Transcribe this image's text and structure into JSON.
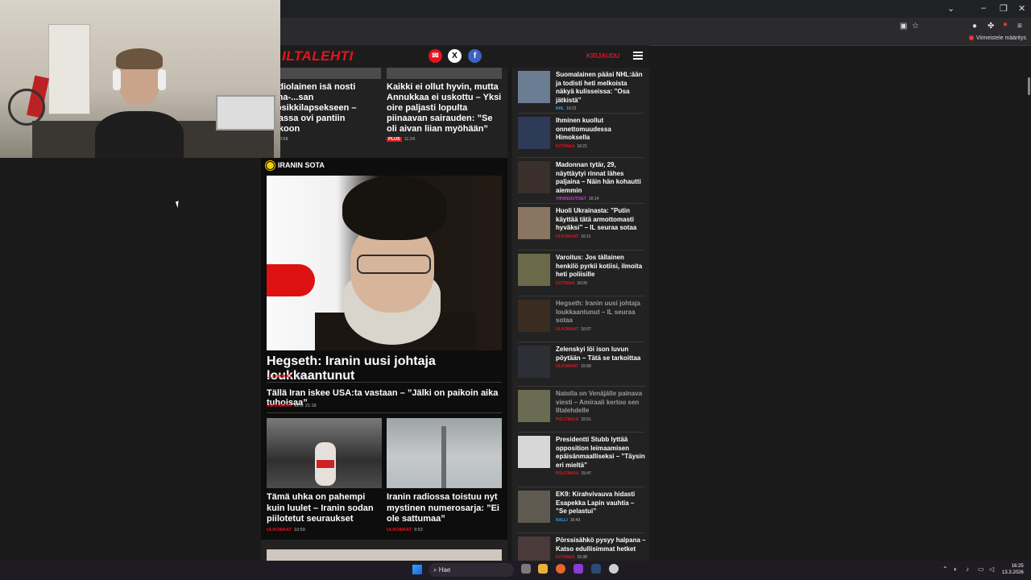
{
  "browser": {
    "bookmark_label": "Viimeistele määritys",
    "minimize": "–",
    "restore": "❐",
    "close": "✕",
    "dropdown": "⌄"
  },
  "site": {
    "logo": "ILTALEHTI",
    "header_right": "KIRJAUDU"
  },
  "top_articles": [
    {
      "title": "...adiolainen isä nosti Anna-...san suosikkilapsekseen – ...nassa ovi pantiin lukkoon",
      "time": "12.3. 20:58",
      "category": ""
    },
    {
      "title": "Kaikki ei ollut hyvin, mutta Annukkaa ei uskottu – Yksi oire paljasti lopulta piinaavan sairauden: ”Se oli aivan liian myöhään”",
      "time": "11:24",
      "badge": "PLUS"
    }
  ],
  "section": {
    "label": "IRANIN SOTA",
    "hero_title": "Hegseth: Iranin uusi johtaja loukkaantunut",
    "hero_category": "ULKOMAAT",
    "hero_time": "16:07",
    "sub_title": "Tällä Iran iskee USA:ta vastaan – ”Jälki on paikoin aika tuhoisaa”",
    "sub_category": "ULKOMAAT",
    "sub_time": "12.3. 21:18",
    "cards": [
      {
        "title": "Tämä uhka on pahempi kuin luulet – Iranin sodan piilotetut seuraukset",
        "category": "ULKOMAAT",
        "time": "10:59"
      },
      {
        "title": "Iranin radiossa toistuu nyt mystinen numerosarja: ”Ei ole sattumaa”",
        "category": "ULKOMAAT",
        "time": "9:53"
      }
    ]
  },
  "sidebar": [
    {
      "title": "Suomalainen pääsi NHL:ään ja todisti heti melkoista näkyä kulisseissa: ”Osa jätkistä”",
      "category": "NHL",
      "cat_color": "#2aa0e6",
      "time": "16:21",
      "dim": false
    },
    {
      "title": "Ihminen kuollut onnettomuudessa Himoksella",
      "category": "KOTIMAA",
      "cat_color": "#e5141d",
      "time": "16:21",
      "dim": false
    },
    {
      "title": "Madonnan tytär, 29, näyttäytyi rinnat lähes paljaina – Näin hän kohautti aiemmin",
      "category": "VIIHDEUUTISET",
      "cat_color": "#c63fd0",
      "time": "16:14",
      "dim": false
    },
    {
      "title": "Huoli Ukrainasta: ”Putin käyttää tätä armottomasti hyväksi” – IL seuraa sotaa",
      "category": "ULKOMAAT",
      "cat_color": "#e5141d",
      "time": "16:11",
      "dim": false
    },
    {
      "title": "Varoitus: Jos tällainen henkilö pyrkii kotiisi, ilmoita heti poliisille",
      "category": "KOTIMAA",
      "cat_color": "#e5141d",
      "time": "16:09",
      "dim": false
    },
    {
      "title": "Hegseth: Iranin uusi johtaja loukkaantunut – IL seuraa sotaa",
      "category": "ULKOMAAT",
      "cat_color": "#e5141d",
      "time": "16:07",
      "dim": true
    },
    {
      "title": "Zelenskyi löi ison luvun pöytään – Tätä se tarkoittaa",
      "category": "ULKOMAAT",
      "cat_color": "#e5141d",
      "time": "15:58",
      "dim": false
    },
    {
      "title": "Natolla on Venäjälle painava viesti – Amiraali kertoo sen Iltalehdelle",
      "category": "POLITIIKKA",
      "cat_color": "#e5141d",
      "time": "15:51",
      "dim": true
    },
    {
      "title": "Presidentti Stubb lyttää opposition leimaamisen epäisänmaalliseksi – ”Täysin eri mieltä”",
      "category": "POLITIIKKA",
      "cat_color": "#e5141d",
      "time": "15:47",
      "dim": false
    },
    {
      "title": "EK9: Kirahvivauva hidasti Esapekka Lapin vauhtia – ”Se pelastui”",
      "category": "RALLI",
      "cat_color": "#2aa0e6",
      "time": "15:43",
      "dim": false
    },
    {
      "title": "Pörssisähkö pysyy halpana – Katso edullisimmat hetket",
      "category": "KOTIMAA",
      "cat_color": "#e5141d",
      "time": "15:38",
      "dim": false
    }
  ],
  "taskbar": {
    "search_placeholder": "Hae",
    "time": "16:25",
    "date": "13.3.2026"
  }
}
